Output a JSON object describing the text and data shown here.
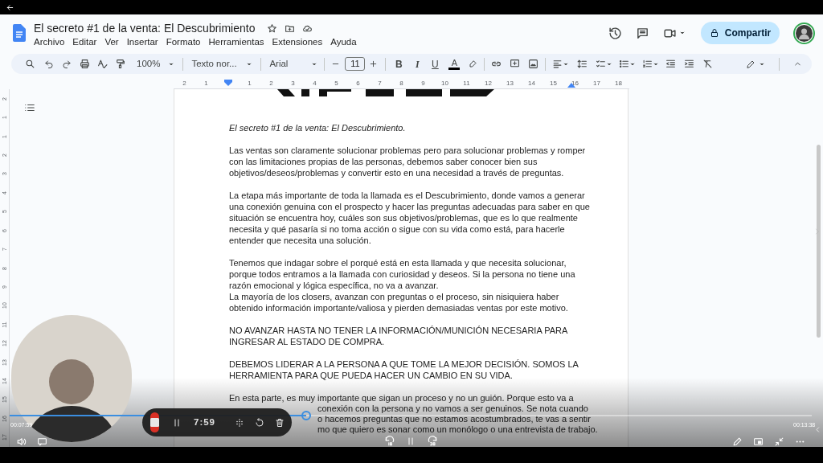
{
  "docs": {
    "title": "El secreto #1 de la venta: El Descubrimiento",
    "menu": [
      "Archivo",
      "Editar",
      "Ver",
      "Insertar",
      "Formato",
      "Herramientas",
      "Extensiones",
      "Ayuda"
    ],
    "share_button": "Compartir",
    "toolbar": {
      "zoom": "100%",
      "style": "Texto nor...",
      "font": "Arial",
      "font_size": "11",
      "bold": "B",
      "italic": "I",
      "underline": "U",
      "text_color": "A"
    },
    "ruler": {
      "horizontal": [
        "2",
        "1",
        "1",
        "2",
        "3",
        "4",
        "5",
        "6",
        "7",
        "8",
        "9",
        "10",
        "11",
        "12",
        "13",
        "14",
        "15",
        "16",
        "17",
        "18"
      ],
      "vertical": [
        "2",
        "1",
        "1",
        "2",
        "3",
        "4",
        "5",
        "6",
        "7",
        "8",
        "9",
        "10",
        "11",
        "12",
        "13",
        "14",
        "15",
        "16",
        "17"
      ]
    },
    "document": [
      {
        "kind": "heading",
        "lines": [
          "El secreto #1 de la venta: El Descubrimiento."
        ]
      },
      {
        "kind": "paragraph",
        "lines": [
          "Las ventas son claramente solucionar problemas pero para solucionar problemas y romper",
          "con las limitaciones propias de las personas, debemos saber conocer bien sus",
          "objetivos/deseos/problemas y convertir esto en una necesidad a través de preguntas."
        ]
      },
      {
        "kind": "paragraph",
        "lines": [
          "La etapa más importante de toda la llamada es el Descubrimiento, donde vamos a generar",
          "una conexión genuina con el prospecto y hacer las preguntas adecuadas para saber en que",
          "situación se encuentra hoy, cuáles son sus objetivos/problemas, que es lo que realmente",
          "necesita y qué pasaría si no toma acción o sigue con su vida como está, para hacerle",
          "entender que necesita una solución."
        ]
      },
      {
        "kind": "paragraph",
        "lines": [
          "Tenemos que indagar sobre el porqué está en esta llamada y que necesita solucionar,",
          "porque todos entramos a la llamada con curiosidad y deseos. Si la persona no tiene una",
          "razón emocional y lógica específica, no va a avanzar."
        ]
      },
      {
        "kind": "continued",
        "lines": [
          "La mayoría de los closers, avanzan con preguntas o el proceso, sin nisiquiera haber",
          "obtenido información importante/valiosa y pierden demasiadas ventas por este motivo."
        ]
      },
      {
        "kind": "paragraph",
        "lines": [
          "NO AVANZAR HASTA NO TENER LA INFORMACIÓN/MUNICIÓN NECESARIA PARA",
          "INGRESAR AL ESTADO DE COMPRA."
        ]
      },
      {
        "kind": "paragraph",
        "lines": [
          "DEBEMOS LIDERAR A LA PERSONA A QUE TOME LA MEJOR DECISIÓN. SOMOS LA",
          "HERRAMIENTA PARA QUE PUEDA HACER UN CAMBIO EN SU VIDA."
        ]
      },
      {
        "kind": "paragraph",
        "lines": [
          "En esta parte, es muy importante que sigan un proceso y no un guión. Porque esto va a"
        ]
      },
      {
        "kind": "partial",
        "lines": [
          "conexión con la persona y no vamos a ser genuinos. Se nota cuando"
        ]
      },
      {
        "kind": "partial",
        "lines": [
          "o hacemos preguntas que no estamos acostumbrados, te vas a sentir"
        ]
      },
      {
        "kind": "partial",
        "lines": [
          "mo que quiero es sonar como un monólogo o una entrevista de trabajo."
        ]
      }
    ]
  },
  "recorder": {
    "time": "7:59"
  },
  "player": {
    "elapsed": "00:07:59",
    "duration": "00:13:38",
    "level": 0.37
  }
}
